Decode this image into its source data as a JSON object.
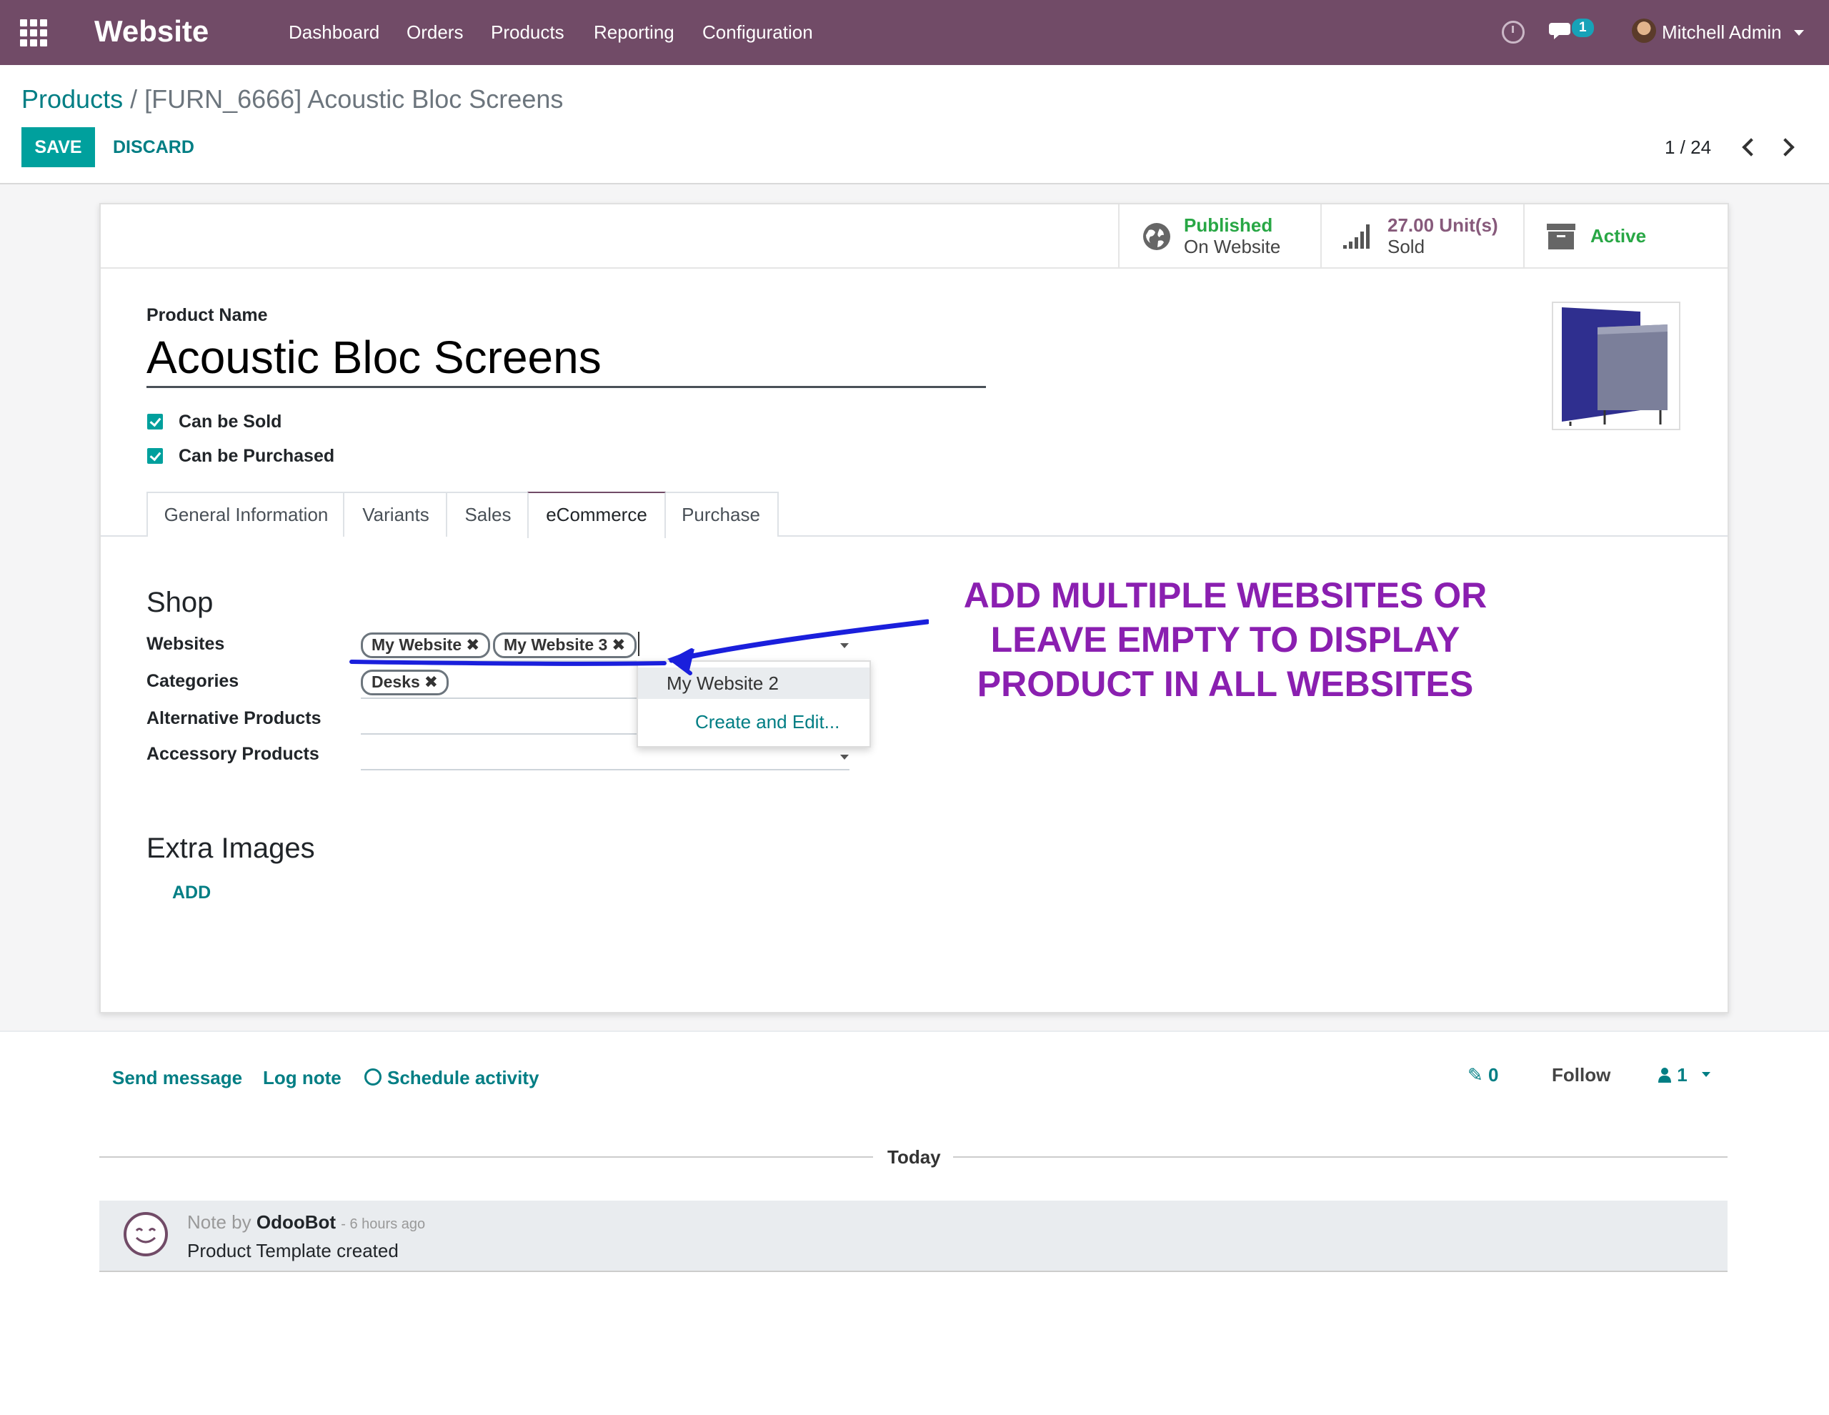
{
  "navbar": {
    "app_name": "Website",
    "menu": [
      "Dashboard",
      "Orders",
      "Products",
      "Reporting",
      "Configuration"
    ],
    "messages_badge": "1",
    "user_name": "Mitchell Admin",
    "accent_color": "#714B67"
  },
  "breadcrumb": {
    "parent": "Products",
    "separator": "/",
    "current": "[FURN_6666] Acoustic Bloc Screens"
  },
  "actions": {
    "save": "SAVE",
    "discard": "DISCARD"
  },
  "pager": {
    "value": "1 / 24"
  },
  "stat_buttons": {
    "published": {
      "line1": "Published",
      "line2": "On Website"
    },
    "sold": {
      "line1": "27.00 Unit(s)",
      "line2": "Sold"
    },
    "active": {
      "label": "Active"
    }
  },
  "form": {
    "product_name_label": "Product Name",
    "product_name": "Acoustic Bloc Screens",
    "can_be_sold": "Can be Sold",
    "can_be_purchased": "Can be Purchased"
  },
  "tabs": [
    "General Information",
    "Variants",
    "Sales",
    "eCommerce",
    "Purchase"
  ],
  "active_tab": "eCommerce",
  "shop": {
    "title": "Shop",
    "websites_label": "Websites",
    "websites_tags": [
      "My Website",
      "My Website 3"
    ],
    "categories_label": "Categories",
    "categories_tags": [
      "Desks"
    ],
    "alternative_label": "Alternative Products",
    "accessory_label": "Accessory Products"
  },
  "autocomplete": {
    "options": [
      "My Website 2"
    ],
    "create_edit": "Create and Edit..."
  },
  "extra_images": {
    "title": "Extra Images",
    "add": "ADD"
  },
  "annotation": {
    "lines": [
      "ADD MULTIPLE WEBSITES OR",
      "LEAVE EMPTY TO DISPLAY",
      "PRODUCT IN ALL WEBSITES"
    ],
    "color": "#8a1fb0",
    "arrow_color": "#1a1fdc"
  },
  "chatter": {
    "send_message": "Send message",
    "log_note": "Log note",
    "schedule_activity": "Schedule activity",
    "attachments_count": "0",
    "follow": "Follow",
    "followers_count": "1",
    "date_separator": "Today",
    "message": {
      "prefix": "Note by",
      "author": "OdooBot",
      "time": "- 6 hours ago",
      "body": "Product Template created"
    }
  }
}
